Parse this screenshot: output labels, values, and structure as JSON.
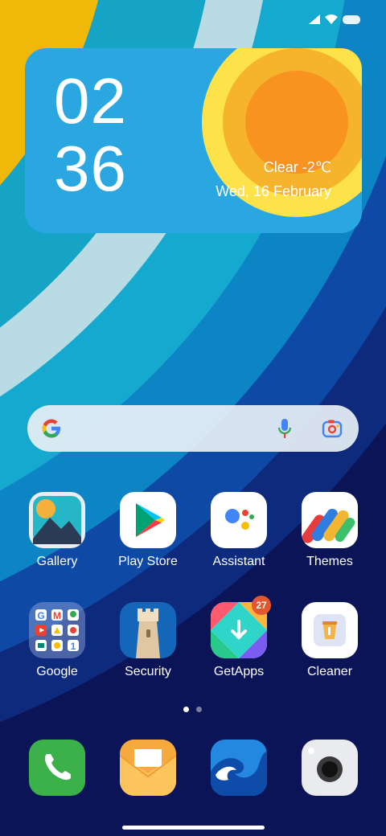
{
  "status_bar": {
    "icons": [
      "signal-icon",
      "wifi-icon",
      "battery-icon"
    ]
  },
  "clock_widget": {
    "hours": "02",
    "minutes": "36",
    "weather": "Clear  -2℃",
    "date": "Wed, 16 February"
  },
  "search_bar": {
    "icons": [
      "google-g-icon",
      "microphone-icon",
      "google-lens-icon"
    ]
  },
  "apps": [
    {
      "label": "Gallery"
    },
    {
      "label": "Play Store"
    },
    {
      "label": "Assistant"
    },
    {
      "label": "Themes"
    },
    {
      "label": "Google"
    },
    {
      "label": "Security"
    },
    {
      "label": "GetApps",
      "badge": "27"
    },
    {
      "label": "Cleaner"
    }
  ],
  "page_indicator": {
    "pages": 2,
    "current": 1
  },
  "dock": [
    "phone-icon",
    "messaging-icon",
    "browser-icon",
    "camera-icon"
  ],
  "colors": {
    "accent_blue": "#2aa7e0",
    "sun_orange": "#f7931e",
    "badge_red": "#e4572e",
    "wallpaper_dark": "#0a1a5c"
  }
}
